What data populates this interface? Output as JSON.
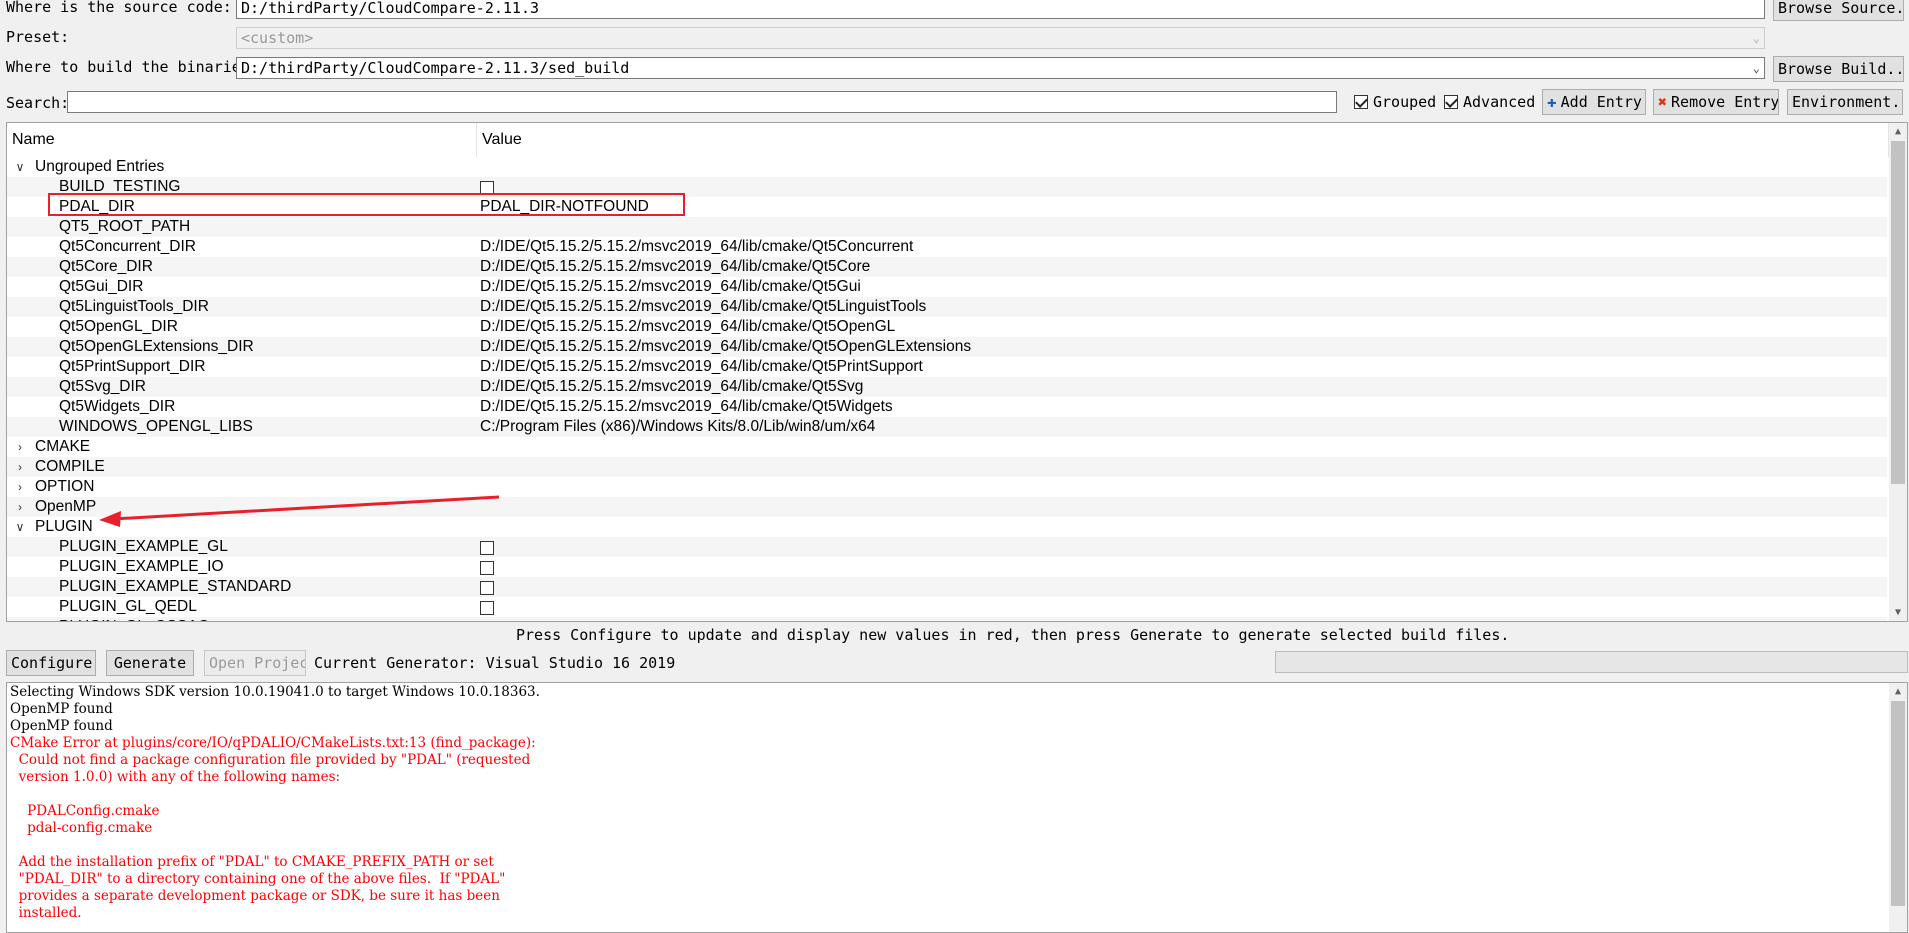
{
  "source": {
    "label": "Where is the source code:",
    "value": "D:/thirdParty/CloudCompare-2.11.3",
    "browse_label": "Browse Source..."
  },
  "preset": {
    "label": "Preset:",
    "value": "<custom>"
  },
  "build": {
    "label": "Where to build the binaries:",
    "value": "D:/thirdParty/CloudCompare-2.11.3/sed_build",
    "browse_label": "Browse Build..."
  },
  "search": {
    "label": "Search:",
    "value": "",
    "grouped_label": "Grouped",
    "grouped_checked": true,
    "advanced_label": "Advanced",
    "advanced_checked": true,
    "add_entry_label": "Add Entry",
    "remove_entry_label": "Remove Entry",
    "environment_label": "Environment..."
  },
  "tree": {
    "col_name": "Name",
    "col_value": "Value",
    "rows": [
      {
        "kind": "group",
        "expanded": true,
        "name": "Ungrouped Entries",
        "value": ""
      },
      {
        "kind": "entry",
        "name": "BUILD_TESTING",
        "value": "",
        "checkbox": true,
        "checked": false
      },
      {
        "kind": "entry",
        "name": "PDAL_DIR",
        "value": "PDAL_DIR-NOTFOUND",
        "highlight": true
      },
      {
        "kind": "entry",
        "name": "QT5_ROOT_PATH",
        "value": ""
      },
      {
        "kind": "entry",
        "name": "Qt5Concurrent_DIR",
        "value": "D:/IDE/Qt5.15.2/5.15.2/msvc2019_64/lib/cmake/Qt5Concurrent"
      },
      {
        "kind": "entry",
        "name": "Qt5Core_DIR",
        "value": "D:/IDE/Qt5.15.2/5.15.2/msvc2019_64/lib/cmake/Qt5Core"
      },
      {
        "kind": "entry",
        "name": "Qt5Gui_DIR",
        "value": "D:/IDE/Qt5.15.2/5.15.2/msvc2019_64/lib/cmake/Qt5Gui"
      },
      {
        "kind": "entry",
        "name": "Qt5LinguistTools_DIR",
        "value": "D:/IDE/Qt5.15.2/5.15.2/msvc2019_64/lib/cmake/Qt5LinguistTools"
      },
      {
        "kind": "entry",
        "name": "Qt5OpenGL_DIR",
        "value": "D:/IDE/Qt5.15.2/5.15.2/msvc2019_64/lib/cmake/Qt5OpenGL"
      },
      {
        "kind": "entry",
        "name": "Qt5OpenGLExtensions_DIR",
        "value": "D:/IDE/Qt5.15.2/5.15.2/msvc2019_64/lib/cmake/Qt5OpenGLExtensions"
      },
      {
        "kind": "entry",
        "name": "Qt5PrintSupport_DIR",
        "value": "D:/IDE/Qt5.15.2/5.15.2/msvc2019_64/lib/cmake/Qt5PrintSupport"
      },
      {
        "kind": "entry",
        "name": "Qt5Svg_DIR",
        "value": "D:/IDE/Qt5.15.2/5.15.2/msvc2019_64/lib/cmake/Qt5Svg"
      },
      {
        "kind": "entry",
        "name": "Qt5Widgets_DIR",
        "value": "D:/IDE/Qt5.15.2/5.15.2/msvc2019_64/lib/cmake/Qt5Widgets"
      },
      {
        "kind": "entry",
        "name": "WINDOWS_OPENGL_LIBS",
        "value": "C:/Program Files (x86)/Windows Kits/8.0/Lib/win8/um/x64"
      },
      {
        "kind": "group",
        "expanded": false,
        "name": "CMAKE",
        "value": ""
      },
      {
        "kind": "group",
        "expanded": false,
        "name": "COMPILE",
        "value": ""
      },
      {
        "kind": "group",
        "expanded": false,
        "name": "OPTION",
        "value": ""
      },
      {
        "kind": "group",
        "expanded": false,
        "name": "OpenMP",
        "value": ""
      },
      {
        "kind": "group",
        "expanded": true,
        "name": "PLUGIN",
        "value": "",
        "arrow_target": true
      },
      {
        "kind": "entry",
        "name": "PLUGIN_EXAMPLE_GL",
        "value": "",
        "checkbox": true,
        "checked": false
      },
      {
        "kind": "entry",
        "name": "PLUGIN_EXAMPLE_IO",
        "value": "",
        "checkbox": true,
        "checked": false
      },
      {
        "kind": "entry",
        "name": "PLUGIN_EXAMPLE_STANDARD",
        "value": "",
        "checkbox": true,
        "checked": false
      },
      {
        "kind": "entry",
        "name": "PLUGIN_GL_QEDL",
        "value": "",
        "checkbox": true,
        "checked": false
      },
      {
        "kind": "entry",
        "name": "PLUGIN_GL_QSSAO",
        "value": "",
        "checkbox": true,
        "checked": false
      }
    ]
  },
  "status_text": "Press Configure to update and display new values in red, then press Generate to generate selected build files.",
  "actions": {
    "configure_label": "Configure",
    "generate_label": "Generate",
    "open_project_label": "Open Project",
    "generator_text": "Current Generator: Visual Studio 16 2019",
    "progress": 0
  },
  "log": [
    {
      "text": "Selecting Windows SDK version 10.0.19041.0 to target Windows 10.0.18363.",
      "error": false
    },
    {
      "text": "OpenMP found",
      "error": false
    },
    {
      "text": "OpenMP found",
      "error": false
    },
    {
      "text": "CMake Error at plugins/core/IO/qPDALIO/CMakeLists.txt:13 (find_package):",
      "error": true
    },
    {
      "text": "  Could not find a package configuration file provided by \"PDAL\" (requested",
      "error": true
    },
    {
      "text": "  version 1.0.0) with any of the following names:",
      "error": true
    },
    {
      "text": "",
      "error": true
    },
    {
      "text": "    PDALConfig.cmake",
      "error": true
    },
    {
      "text": "    pdal-config.cmake",
      "error": true
    },
    {
      "text": "",
      "error": true
    },
    {
      "text": "  Add the installation prefix of \"PDAL\" to CMAKE_PREFIX_PATH or set",
      "error": true
    },
    {
      "text": "  \"PDAL_DIR\" to a directory containing one of the above files.  If \"PDAL\"",
      "error": true
    },
    {
      "text": "  provides a separate development package or SDK, be sure it has been",
      "error": true
    },
    {
      "text": "  installed.",
      "error": true
    }
  ],
  "colors": {
    "error_text": "#ff0000",
    "annotation": "#e8202a",
    "window_bg": "#f0f0f0"
  }
}
